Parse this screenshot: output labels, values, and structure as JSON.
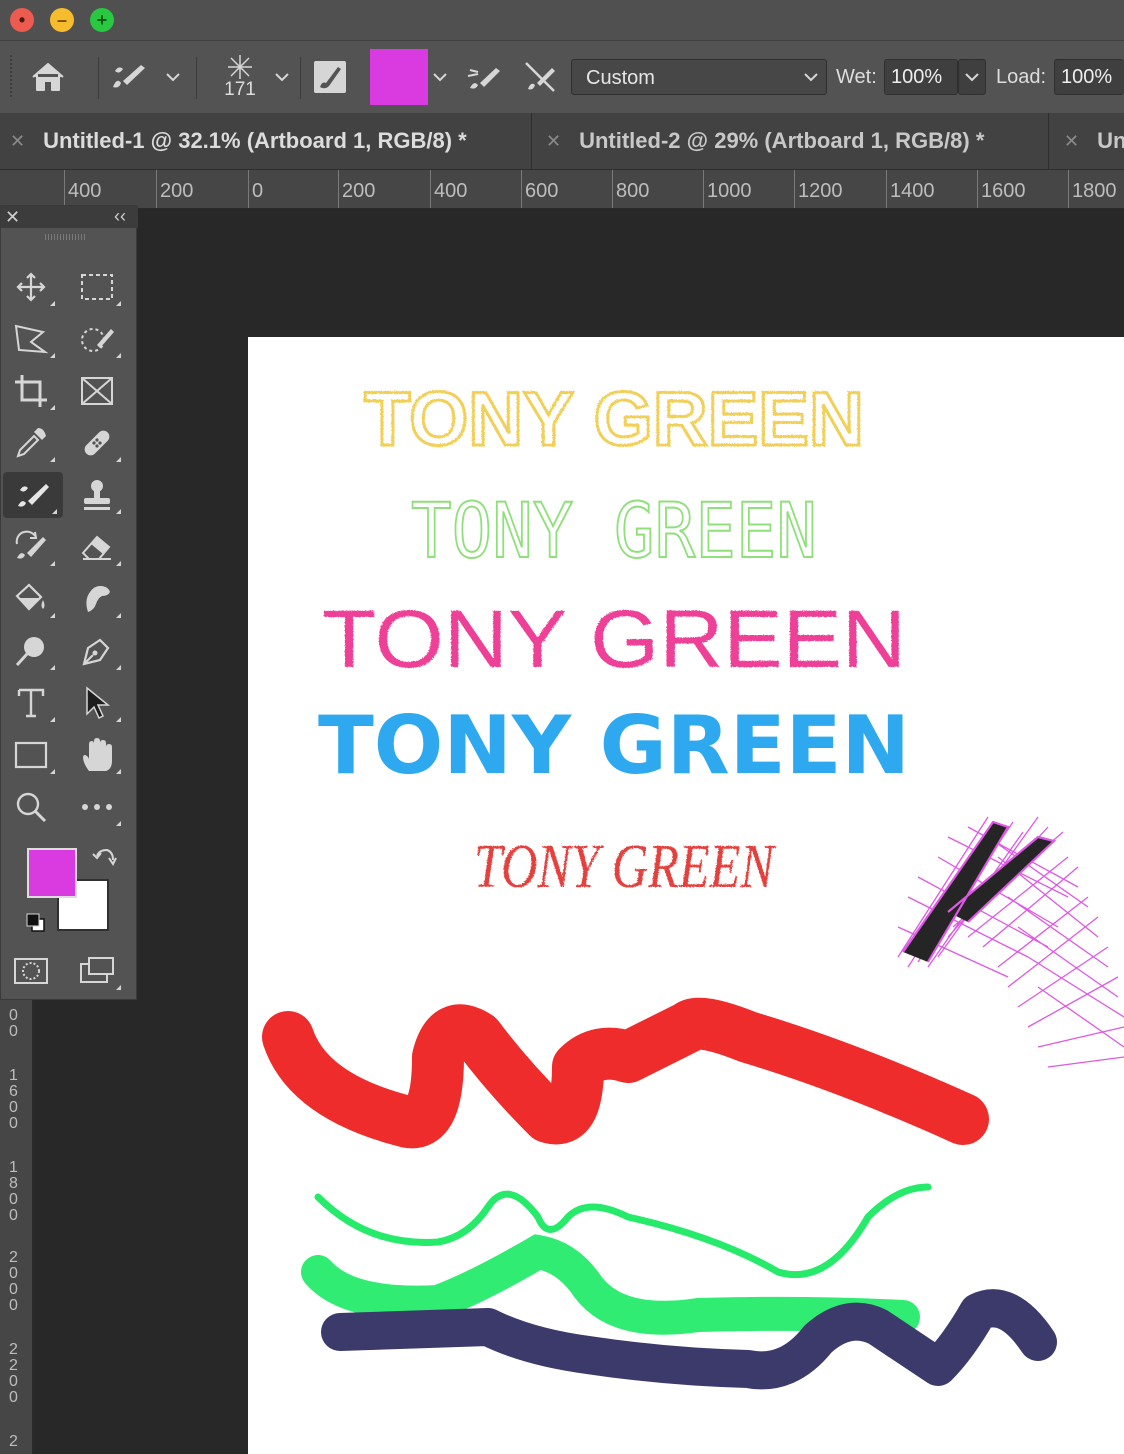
{
  "window": {
    "controls": [
      "close",
      "minimize",
      "maximize"
    ]
  },
  "options_bar": {
    "brush_size": "171",
    "current_color": "#d93be0",
    "preset": "Custom",
    "wet_label": "Wet:",
    "wet_value": "100%",
    "load_label": "Load:",
    "load_value": "100%"
  },
  "tabs": [
    {
      "label": "Untitled-1 @ 32.1% (Artboard 1, RGB/8) *"
    },
    {
      "label": "Untitled-2 @ 29% (Artboard 1, RGB/8) *"
    },
    {
      "label": "Un"
    }
  ],
  "ruler_h": [
    "400",
    "200",
    "0",
    "200",
    "400",
    "600",
    "800",
    "1000",
    "1200",
    "1400",
    "1600",
    "1800"
  ],
  "ruler_v": [
    "0\n0",
    "1\n6\n0\n0",
    "1\n8\n0\n0",
    "2\n0\n0\n0",
    "2\n2\n0\n0",
    "2"
  ],
  "tools": [
    "move-tool",
    "marquee-tool",
    "lasso-tool",
    "quick-selection-tool",
    "crop-tool",
    "frame-tool",
    "eyedropper-tool",
    "healing-brush-tool",
    "mixer-brush-tool",
    "clone-stamp-tool",
    "history-brush-tool",
    "eraser-tool",
    "paint-bucket-tool",
    "smudge-tool",
    "dodge-tool",
    "pen-tool",
    "type-tool",
    "path-selection-tool",
    "rectangle-tool",
    "hand-tool",
    "zoom-tool",
    "more-tools"
  ],
  "colors": {
    "foreground": "#d93be0",
    "background": "#ffffff"
  },
  "artboard": {
    "texts": [
      {
        "text": "TONY GREEN",
        "color": "#f2cf57"
      },
      {
        "text": "TONY GREEN",
        "color": "#8fe07a"
      },
      {
        "text": "TONY GREEN",
        "color": "#ef3f97"
      },
      {
        "text": "TONY GREEN",
        "color": "#2ea9ef"
      },
      {
        "text": "TONY GREEN",
        "color": "#e4403c"
      }
    ],
    "stroke_colors": {
      "red": "#ee2c2c",
      "green": "#26eb6a",
      "navy": "#3b3a6b",
      "magenta": "#d93be0"
    }
  }
}
